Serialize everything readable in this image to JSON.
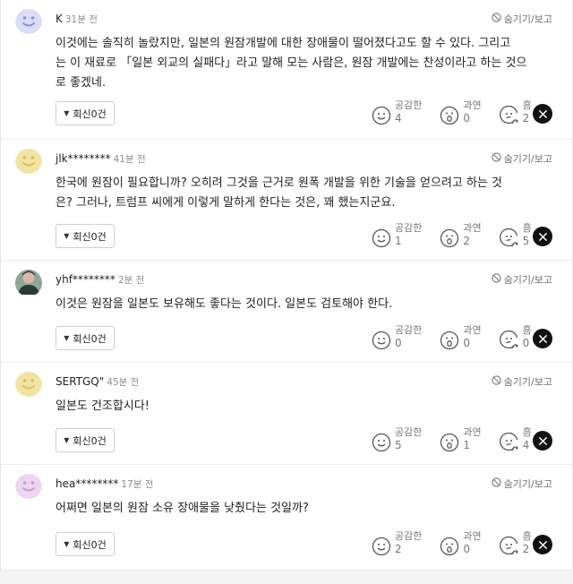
{
  "comments": [
    {
      "name": "K",
      "time": "31분 전",
      "avatar": {
        "bg": "#dcdcf5",
        "fg": "#8e8ede",
        "icon": "smiley-face-icon"
      },
      "hide_label": "숨기기/보고",
      "lines": [
        "이것에는 솔직히 놀랐지만, 일본의 원잠개발에 대한 장애물이 떨어졌다고도 할 수 있다. 그리고",
        "는 이 재료로 「일본 외교의 실패다」라고 말해 모는 사람은, 원잠 개발에는 찬성이라고 하는 것으",
        "로 좋겠네."
      ],
      "reply_label": "회신0건",
      "reactions": [
        {
          "label": "공감한",
          "count": "4",
          "icon": "smiley-face-icon"
        },
        {
          "label": "과연",
          "count": "0",
          "icon": "surprised-face-icon"
        },
        {
          "label": "흠",
          "count": "2",
          "icon": "thinking-face-icon"
        }
      ]
    },
    {
      "name": "jlk********",
      "time": "41분 전",
      "avatar": {
        "bg": "#f1e3a4",
        "fg": "#d8bf5c",
        "icon": "smiley-face-icon"
      },
      "hide_label": "숨기기/보고",
      "lines": [
        "한국에 원잠이 필요합니까? 오히려 그것을 근거로 원폭 개발을 위한 기술을 얻으려고 하는 것",
        "은? 그러나, 트럼프 씨에게 이렇게 말하게 한다는 것은, 꽤 했는지군요."
      ],
      "reply_label": "회신0건",
      "reactions": [
        {
          "label": "공감한",
          "count": "1",
          "icon": "smiley-face-icon"
        },
        {
          "label": "과연",
          "count": "2",
          "icon": "surprised-face-icon"
        },
        {
          "label": "흠",
          "count": "5",
          "icon": "thinking-face-icon"
        }
      ]
    },
    {
      "name": "yhf********",
      "time": "2분 전",
      "avatar": {
        "bg": "#8ea59a",
        "fg": "#2d3b38",
        "icon": "user-photo-icon"
      },
      "hide_label": "숨기기/보고",
      "lines": [
        "이것은 원잠을 일본도 보유해도 좋다는 것이다. 일본도 검토해야 한다."
      ],
      "reply_label": "회신0건",
      "reactions": [
        {
          "label": "공감한",
          "count": "0",
          "icon": "smiley-face-icon"
        },
        {
          "label": "과연",
          "count": "0",
          "icon": "surprised-face-icon"
        },
        {
          "label": "흠",
          "count": "0",
          "icon": "thinking-face-icon"
        }
      ]
    },
    {
      "name": "SERTGQ\"",
      "time": "45분 전",
      "avatar": {
        "bg": "#f1e3a4",
        "fg": "#d8bf5c",
        "icon": "smiley-face-icon"
      },
      "hide_label": "숨기기/보고",
      "lines": [
        "일본도 건조합시다!"
      ],
      "reply_label": "회신0건",
      "reactions": [
        {
          "label": "공감한",
          "count": "5",
          "icon": "smiley-face-icon"
        },
        {
          "label": "과연",
          "count": "1",
          "icon": "surprised-face-icon"
        },
        {
          "label": "흠",
          "count": "4",
          "icon": "thinking-face-icon"
        }
      ]
    },
    {
      "name": "hea********",
      "time": "17분 전",
      "avatar": {
        "bg": "#ecd6ef",
        "fg": "#c79bd0",
        "icon": "smiley-face-icon"
      },
      "hide_label": "숨기기/보고",
      "lines": [
        "어쩌면 일본의 원잠 소유 장애물을 낮췄다는 것일까?"
      ],
      "reply_label": "회신0건",
      "reactions": [
        {
          "label": "공감한",
          "count": "2",
          "icon": "smiley-face-icon"
        },
        {
          "label": "과연",
          "count": "0",
          "icon": "surprised-face-icon"
        },
        {
          "label": "흠",
          "count": "2",
          "icon": "thinking-face-icon"
        }
      ]
    }
  ]
}
